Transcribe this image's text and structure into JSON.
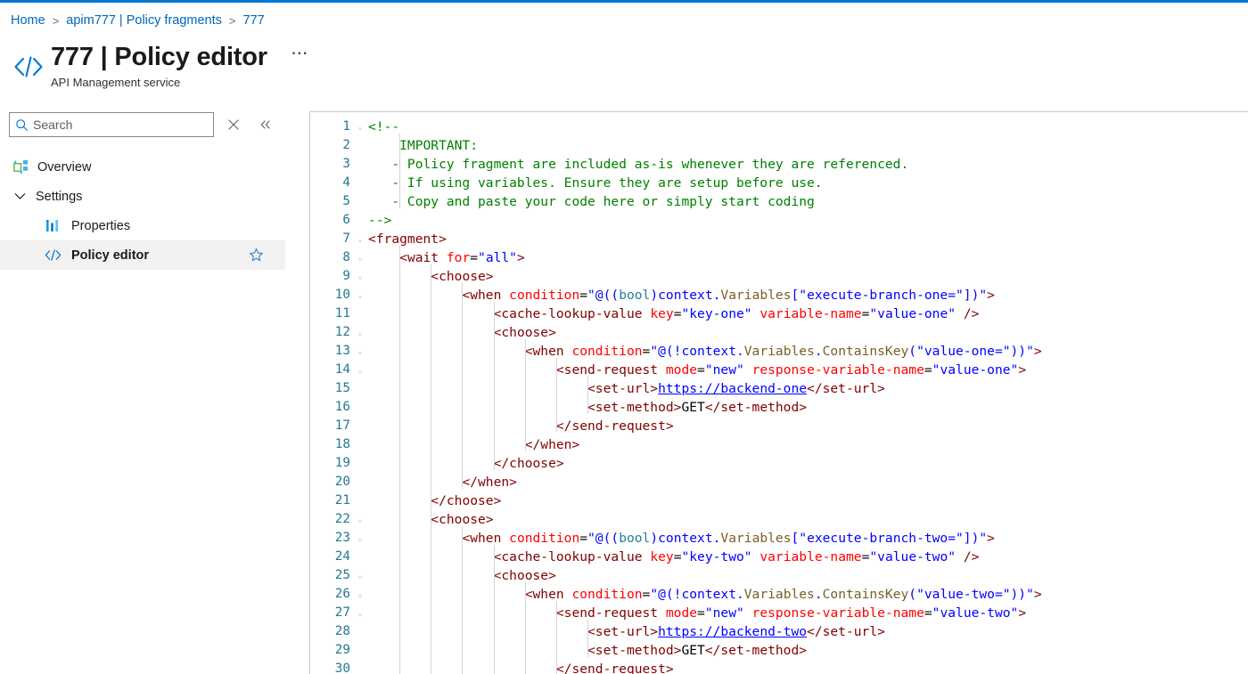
{
  "theme": {
    "accent": "#0078d4",
    "link": "#0067b8",
    "selected_bg": "#f3f2f1",
    "border": "#c8c6c4",
    "linenumber": "#237893"
  },
  "breadcrumb": {
    "items": [
      {
        "label": "Home"
      },
      {
        "label": "apim777 | Policy fragments"
      },
      {
        "label": "777"
      }
    ],
    "separator": ">"
  },
  "header": {
    "icon": "code-brackets-icon",
    "title": "777 | Policy editor",
    "subtitle": "API Management service",
    "more_label": "⋯"
  },
  "sidebar": {
    "search": {
      "placeholder": "Search",
      "value": "",
      "icon": "search-icon"
    },
    "actions": [
      {
        "name": "close-icon",
        "glyph": "✕"
      },
      {
        "name": "collapse-icon",
        "glyph": "«"
      }
    ],
    "items": [
      {
        "label": "Overview",
        "icon": "overview-icon",
        "type": "item",
        "selected": false
      },
      {
        "label": "Settings",
        "icon": "chevron-down-icon",
        "type": "group",
        "selected": false,
        "expanded": true
      },
      {
        "label": "Properties",
        "icon": "properties-icon",
        "type": "child",
        "selected": false
      },
      {
        "label": "Policy editor",
        "icon": "code-icon",
        "type": "child",
        "selected": true,
        "favorite": true
      }
    ]
  },
  "editor": {
    "language": "xml",
    "first_visible_line": 1,
    "last_visible_line": 30,
    "lines": [
      {
        "n": 1,
        "indent": 0,
        "fold": "⌄",
        "tokens": [
          {
            "c": "t-com",
            "t": "<!--"
          }
        ]
      },
      {
        "n": 2,
        "indent": 1,
        "fold": "",
        "tokens": [
          {
            "c": "t-com",
            "t": "    IMPORTANT:"
          }
        ]
      },
      {
        "n": 3,
        "indent": 1,
        "fold": "",
        "tokens": [
          {
            "c": "t-com",
            "t": "   - Policy fragment are included as-is whenever they are referenced."
          }
        ]
      },
      {
        "n": 4,
        "indent": 1,
        "fold": "",
        "tokens": [
          {
            "c": "t-com",
            "t": "   - If using variables. Ensure they are setup before use."
          }
        ]
      },
      {
        "n": 5,
        "indent": 1,
        "fold": "",
        "tokens": [
          {
            "c": "t-com",
            "t": "   - Copy and paste your code here or simply start coding"
          }
        ]
      },
      {
        "n": 6,
        "indent": 0,
        "fold": "",
        "tokens": [
          {
            "c": "t-com",
            "t": "-->"
          }
        ]
      },
      {
        "n": 7,
        "indent": 0,
        "fold": "⌄",
        "tokens": [
          {
            "c": "t-tag",
            "t": "<fragment>"
          }
        ]
      },
      {
        "n": 8,
        "indent": 1,
        "fold": "⌄",
        "tokens": [
          {
            "c": "t-plain",
            "t": "    "
          },
          {
            "c": "t-tag",
            "t": "<wait "
          },
          {
            "c": "t-attr",
            "t": "for"
          },
          {
            "c": "t-punct",
            "t": "="
          },
          {
            "c": "t-val",
            "t": "\"all\""
          },
          {
            "c": "t-tag",
            "t": ">"
          }
        ]
      },
      {
        "n": 9,
        "indent": 2,
        "fold": "⌄",
        "tokens": [
          {
            "c": "t-plain",
            "t": "        "
          },
          {
            "c": "t-tag",
            "t": "<choose>"
          }
        ]
      },
      {
        "n": 10,
        "indent": 3,
        "fold": "⌄",
        "tokens": [
          {
            "c": "t-plain",
            "t": "            "
          },
          {
            "c": "t-tag",
            "t": "<when "
          },
          {
            "c": "t-attr",
            "t": "condition"
          },
          {
            "c": "t-punct",
            "t": "="
          },
          {
            "c": "t-val",
            "t": "\"@(("
          },
          {
            "c": "t-type",
            "t": "bool"
          },
          {
            "c": "t-val",
            "t": ")context."
          },
          {
            "c": "t-fn",
            "t": "Variables"
          },
          {
            "c": "t-val",
            "t": "[\"execute-branch-one=\"])\""
          },
          {
            "c": "t-tag",
            "t": ">"
          }
        ]
      },
      {
        "n": 11,
        "indent": 4,
        "fold": "",
        "tokens": [
          {
            "c": "t-plain",
            "t": "                "
          },
          {
            "c": "t-tag",
            "t": "<cache-lookup-value "
          },
          {
            "c": "t-attr",
            "t": "key"
          },
          {
            "c": "t-punct",
            "t": "="
          },
          {
            "c": "t-val",
            "t": "\"key-one\""
          },
          {
            "c": "t-plain",
            "t": " "
          },
          {
            "c": "t-attr",
            "t": "variable-name"
          },
          {
            "c": "t-punct",
            "t": "="
          },
          {
            "c": "t-val",
            "t": "\"value-one\""
          },
          {
            "c": "t-plain",
            "t": " "
          },
          {
            "c": "t-tag",
            "t": "/>"
          }
        ]
      },
      {
        "n": 12,
        "indent": 4,
        "fold": "⌄",
        "tokens": [
          {
            "c": "t-plain",
            "t": "                "
          },
          {
            "c": "t-tag",
            "t": "<choose>"
          }
        ]
      },
      {
        "n": 13,
        "indent": 5,
        "fold": "⌄",
        "tokens": [
          {
            "c": "t-plain",
            "t": "                    "
          },
          {
            "c": "t-tag",
            "t": "<when "
          },
          {
            "c": "t-attr",
            "t": "condition"
          },
          {
            "c": "t-punct",
            "t": "="
          },
          {
            "c": "t-val",
            "t": "\"@(!context."
          },
          {
            "c": "t-fn",
            "t": "Variables"
          },
          {
            "c": "t-val",
            "t": "."
          },
          {
            "c": "t-fn",
            "t": "ContainsKey"
          },
          {
            "c": "t-val",
            "t": "(\"value-one=\"))\""
          },
          {
            "c": "t-tag",
            "t": ">"
          }
        ]
      },
      {
        "n": 14,
        "indent": 6,
        "fold": "⌄",
        "tokens": [
          {
            "c": "t-plain",
            "t": "                        "
          },
          {
            "c": "t-tag",
            "t": "<send-request "
          },
          {
            "c": "t-attr",
            "t": "mode"
          },
          {
            "c": "t-punct",
            "t": "="
          },
          {
            "c": "t-val",
            "t": "\"new\""
          },
          {
            "c": "t-plain",
            "t": " "
          },
          {
            "c": "t-attr",
            "t": "response-variable-name"
          },
          {
            "c": "t-punct",
            "t": "="
          },
          {
            "c": "t-val",
            "t": "\"value-one\""
          },
          {
            "c": "t-tag",
            "t": ">"
          }
        ]
      },
      {
        "n": 15,
        "indent": 7,
        "fold": "",
        "tokens": [
          {
            "c": "t-plain",
            "t": "                            "
          },
          {
            "c": "t-tag",
            "t": "<set-url>"
          },
          {
            "c": "t-link",
            "t": "https://backend-one"
          },
          {
            "c": "t-tag",
            "t": "</set-url>"
          }
        ]
      },
      {
        "n": 16,
        "indent": 7,
        "fold": "",
        "tokens": [
          {
            "c": "t-plain",
            "t": "                            "
          },
          {
            "c": "t-tag",
            "t": "<set-method>"
          },
          {
            "c": "t-plain",
            "t": "GET"
          },
          {
            "c": "t-tag",
            "t": "</set-method>"
          }
        ]
      },
      {
        "n": 17,
        "indent": 6,
        "fold": "",
        "tokens": [
          {
            "c": "t-plain",
            "t": "                        "
          },
          {
            "c": "t-tag",
            "t": "</send-request>"
          }
        ]
      },
      {
        "n": 18,
        "indent": 5,
        "fold": "",
        "tokens": [
          {
            "c": "t-plain",
            "t": "                    "
          },
          {
            "c": "t-tag",
            "t": "</when>"
          }
        ]
      },
      {
        "n": 19,
        "indent": 4,
        "fold": "",
        "tokens": [
          {
            "c": "t-plain",
            "t": "                "
          },
          {
            "c": "t-tag",
            "t": "</choose>"
          }
        ]
      },
      {
        "n": 20,
        "indent": 3,
        "fold": "",
        "tokens": [
          {
            "c": "t-plain",
            "t": "            "
          },
          {
            "c": "t-tag",
            "t": "</when>"
          }
        ]
      },
      {
        "n": 21,
        "indent": 2,
        "fold": "",
        "tokens": [
          {
            "c": "t-plain",
            "t": "        "
          },
          {
            "c": "t-tag",
            "t": "</choose>"
          }
        ]
      },
      {
        "n": 22,
        "indent": 2,
        "fold": "⌄",
        "tokens": [
          {
            "c": "t-plain",
            "t": "        "
          },
          {
            "c": "t-tag",
            "t": "<choose>"
          }
        ]
      },
      {
        "n": 23,
        "indent": 3,
        "fold": "⌄",
        "tokens": [
          {
            "c": "t-plain",
            "t": "            "
          },
          {
            "c": "t-tag",
            "t": "<when "
          },
          {
            "c": "t-attr",
            "t": "condition"
          },
          {
            "c": "t-punct",
            "t": "="
          },
          {
            "c": "t-val",
            "t": "\"@(("
          },
          {
            "c": "t-type",
            "t": "bool"
          },
          {
            "c": "t-val",
            "t": ")context."
          },
          {
            "c": "t-fn",
            "t": "Variables"
          },
          {
            "c": "t-val",
            "t": "[\"execute-branch-two=\"])\""
          },
          {
            "c": "t-tag",
            "t": ">"
          }
        ]
      },
      {
        "n": 24,
        "indent": 4,
        "fold": "",
        "tokens": [
          {
            "c": "t-plain",
            "t": "                "
          },
          {
            "c": "t-tag",
            "t": "<cache-lookup-value "
          },
          {
            "c": "t-attr",
            "t": "key"
          },
          {
            "c": "t-punct",
            "t": "="
          },
          {
            "c": "t-val",
            "t": "\"key-two\""
          },
          {
            "c": "t-plain",
            "t": " "
          },
          {
            "c": "t-attr",
            "t": "variable-name"
          },
          {
            "c": "t-punct",
            "t": "="
          },
          {
            "c": "t-val",
            "t": "\"value-two\""
          },
          {
            "c": "t-plain",
            "t": " "
          },
          {
            "c": "t-tag",
            "t": "/>"
          }
        ]
      },
      {
        "n": 25,
        "indent": 4,
        "fold": "⌄",
        "tokens": [
          {
            "c": "t-plain",
            "t": "                "
          },
          {
            "c": "t-tag",
            "t": "<choose>"
          }
        ]
      },
      {
        "n": 26,
        "indent": 5,
        "fold": "⌄",
        "tokens": [
          {
            "c": "t-plain",
            "t": "                    "
          },
          {
            "c": "t-tag",
            "t": "<when "
          },
          {
            "c": "t-attr",
            "t": "condition"
          },
          {
            "c": "t-punct",
            "t": "="
          },
          {
            "c": "t-val",
            "t": "\"@(!context."
          },
          {
            "c": "t-fn",
            "t": "Variables"
          },
          {
            "c": "t-val",
            "t": "."
          },
          {
            "c": "t-fn",
            "t": "ContainsKey"
          },
          {
            "c": "t-val",
            "t": "(\"value-two=\"))\""
          },
          {
            "c": "t-tag",
            "t": ">"
          }
        ]
      },
      {
        "n": 27,
        "indent": 6,
        "fold": "⌄",
        "tokens": [
          {
            "c": "t-plain",
            "t": "                        "
          },
          {
            "c": "t-tag",
            "t": "<send-request "
          },
          {
            "c": "t-attr",
            "t": "mode"
          },
          {
            "c": "t-punct",
            "t": "="
          },
          {
            "c": "t-val",
            "t": "\"new\""
          },
          {
            "c": "t-plain",
            "t": " "
          },
          {
            "c": "t-attr",
            "t": "response-variable-name"
          },
          {
            "c": "t-punct",
            "t": "="
          },
          {
            "c": "t-val",
            "t": "\"value-two\""
          },
          {
            "c": "t-tag",
            "t": ">"
          }
        ]
      },
      {
        "n": 28,
        "indent": 7,
        "fold": "",
        "tokens": [
          {
            "c": "t-plain",
            "t": "                            "
          },
          {
            "c": "t-tag",
            "t": "<set-url>"
          },
          {
            "c": "t-link",
            "t": "https://backend-two"
          },
          {
            "c": "t-tag",
            "t": "</set-url>"
          }
        ]
      },
      {
        "n": 29,
        "indent": 7,
        "fold": "",
        "tokens": [
          {
            "c": "t-plain",
            "t": "                            "
          },
          {
            "c": "t-tag",
            "t": "<set-method>"
          },
          {
            "c": "t-plain",
            "t": "GET"
          },
          {
            "c": "t-tag",
            "t": "</set-method>"
          }
        ]
      },
      {
        "n": 30,
        "indent": 6,
        "fold": "",
        "tokens": [
          {
            "c": "t-plain",
            "t": "                        "
          },
          {
            "c": "t-tag",
            "t": "</send-request>"
          }
        ]
      }
    ]
  }
}
